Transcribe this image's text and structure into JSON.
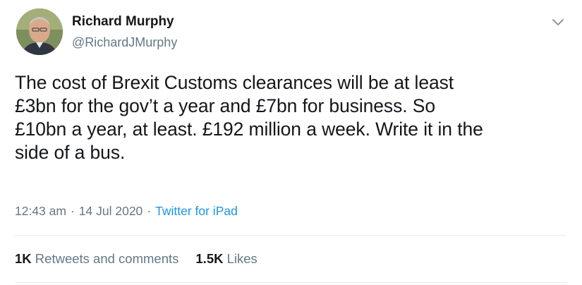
{
  "author": {
    "display_name": "Richard Murphy",
    "handle": "@RichardJMurphy"
  },
  "tweet": {
    "text": "The cost of Brexit Customs clearances will be at least\n£3bn for the gov’t a year and £7bn for business. So\n£10bn a year, at least. £192 million a week. Write it in the\nside of a bus.",
    "time": "12:43 am",
    "date": "14 Jul 2020",
    "separator": "·",
    "source": "Twitter for iPad"
  },
  "stats": {
    "retweets_count": "1K",
    "retweets_label": "Retweets and comments",
    "likes_count": "1.5K",
    "likes_label": "Likes"
  },
  "icons": {
    "menu": "chevron-down-icon",
    "avatar": "avatar"
  },
  "colors": {
    "text": "#14171a",
    "secondary": "#657786",
    "link": "#1b95e0",
    "divider": "#e6ecf0"
  }
}
